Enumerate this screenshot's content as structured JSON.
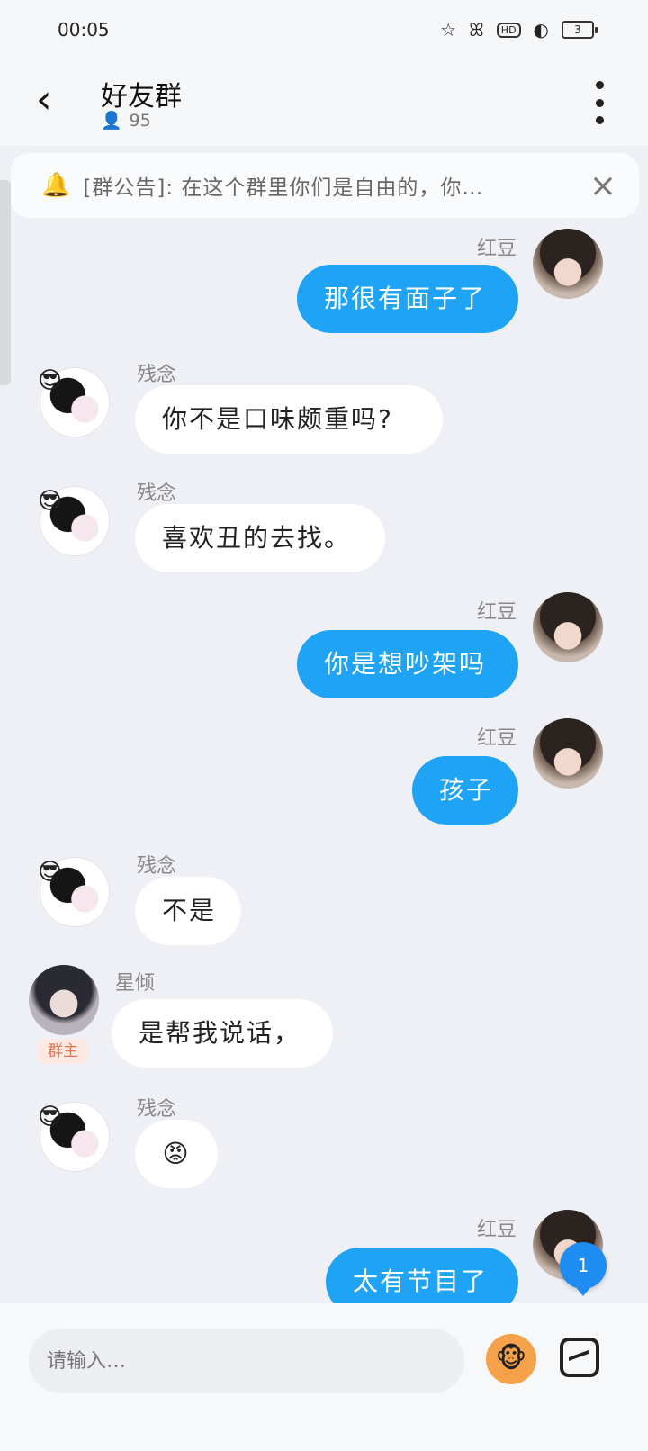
{
  "status": {
    "time": "00:05",
    "battery": "3"
  },
  "header": {
    "title": "好友群",
    "member_count": "95"
  },
  "notice": {
    "text": "[群公告]: 在这个群里你们是自由的，你…"
  },
  "messages": [
    {
      "sender": "红豆",
      "text": "那很有面子了",
      "side": "out"
    },
    {
      "sender": "残念",
      "text": "你不是口味颇重吗?",
      "side": "in"
    },
    {
      "sender": "残念",
      "text": "喜欢丑的去找。",
      "side": "in"
    },
    {
      "sender": "红豆",
      "text": "你是想吵架吗",
      "side": "out"
    },
    {
      "sender": "红豆",
      "text": "孩子",
      "side": "out"
    },
    {
      "sender": "残念",
      "text": "不是",
      "side": "in"
    },
    {
      "sender": "星倾",
      "text": "是帮我说话，",
      "side": "in",
      "badge": "群主"
    },
    {
      "sender": "残念",
      "text": "😡",
      "side": "in"
    },
    {
      "sender": "红豆",
      "text": "太有节目了",
      "side": "out"
    }
  ],
  "unread_count": "1",
  "input": {
    "placeholder": "请输入…"
  }
}
